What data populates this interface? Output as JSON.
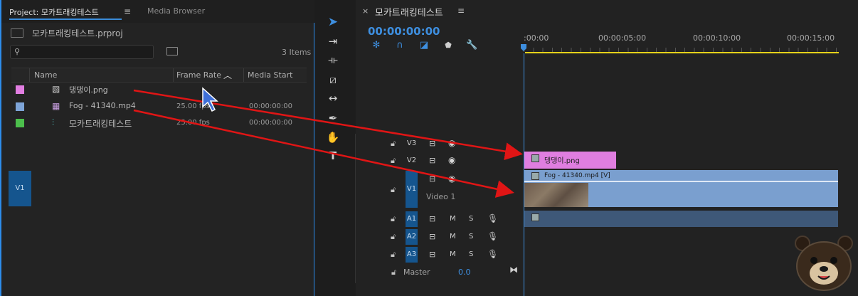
{
  "project_panel": {
    "tab_project": "Project: 모카트래킹테스트",
    "tab_menu": "≡",
    "tab_media_browser": "Media Browser",
    "project_file": "모카트래킹테스트.prproj",
    "search_placeholder": "",
    "items_count": "3 Items",
    "columns": {
      "name": "Name",
      "frame_rate": "Frame Rate",
      "media_start": "Media Start"
    },
    "items": [
      {
        "name": "댕댕이.png",
        "frame_rate": "",
        "media_start": "",
        "color": "#e27ee2",
        "icon": "image-icon"
      },
      {
        "name": "Fog - 41340.mp4",
        "frame_rate": "25.00 fps",
        "media_start": "00:00:00:00",
        "color": "#7ea5d8",
        "icon": "video-clip-icon"
      },
      {
        "name": "모카트래킹테스트",
        "frame_rate": "25.00 fps",
        "media_start": "00:00:00:00",
        "color": "#4cbf4c",
        "icon": "sequence-icon"
      }
    ]
  },
  "tools": [
    "selection-tool",
    "track-select-tool",
    "ripple-edit-tool",
    "razor-tool",
    "slip-tool",
    "pen-tool",
    "hand-tool",
    "type-tool"
  ],
  "timeline": {
    "close": "×",
    "title": "모카트래킹테스트",
    "menu": "≡",
    "timecode": "00:00:00:00",
    "ruler_labels": [
      ":00:00",
      "00:00:05:00",
      "00:00:10:00",
      "00:00:15:00"
    ],
    "source_patch": "V1",
    "video_tracks": [
      {
        "label": "V3"
      },
      {
        "label": "V2"
      },
      {
        "label": "V1",
        "name": "Video 1"
      }
    ],
    "audio_tracks": [
      {
        "label": "A1",
        "mute": "M",
        "solo": "S"
      },
      {
        "label": "A2",
        "mute": "M",
        "solo": "S"
      },
      {
        "label": "A3",
        "mute": "M",
        "solo": "S"
      }
    ],
    "master_label": "Master",
    "master_value": "0.0",
    "clips": {
      "dog": "댕댕이.png",
      "fog": "Fog - 41340.mp4 [V]"
    }
  },
  "colors": {
    "accent": "#3e8fe0",
    "work_area": "#e6d21a",
    "annotation_arrow": "#e01515"
  }
}
